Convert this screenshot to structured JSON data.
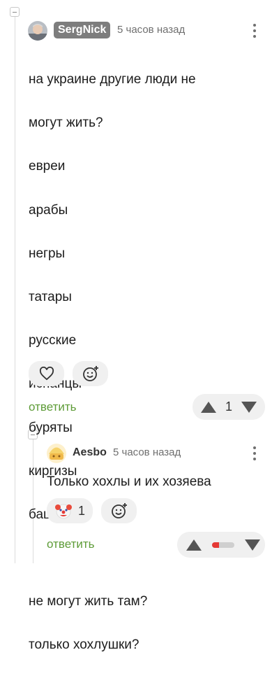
{
  "comment": {
    "username": "SergNick",
    "time": "5 часов назад",
    "lines": [
      "на украине другие люди не",
      "могут жить?",
      "евреи",
      "арабы",
      "негры",
      "татары",
      "русские",
      "испанцы",
      "буряты",
      "киргизы",
      "башкиры",
      "",
      "не могут жить там?",
      "только хохлушки?"
    ],
    "reply_label": "ответить",
    "rating": "1",
    "like_icon": "heart-icon",
    "add_reaction_icon": "add-reaction-icon"
  },
  "reply": {
    "username": "Aesbo",
    "time": "5 часов назад",
    "text": "Только хохлы и их хозяева",
    "reaction_icon": "clown-emoji",
    "reaction_count": "1",
    "add_reaction_icon": "add-reaction-icon",
    "reply_label": "ответить",
    "rating_bar": {
      "positive_fraction": 0.3,
      "positive_color": "#e53935",
      "negative_color": "#cfcfcf"
    }
  },
  "colors": {
    "reply_link": "#5e9c38",
    "username_badge": "#7d7d7d"
  }
}
